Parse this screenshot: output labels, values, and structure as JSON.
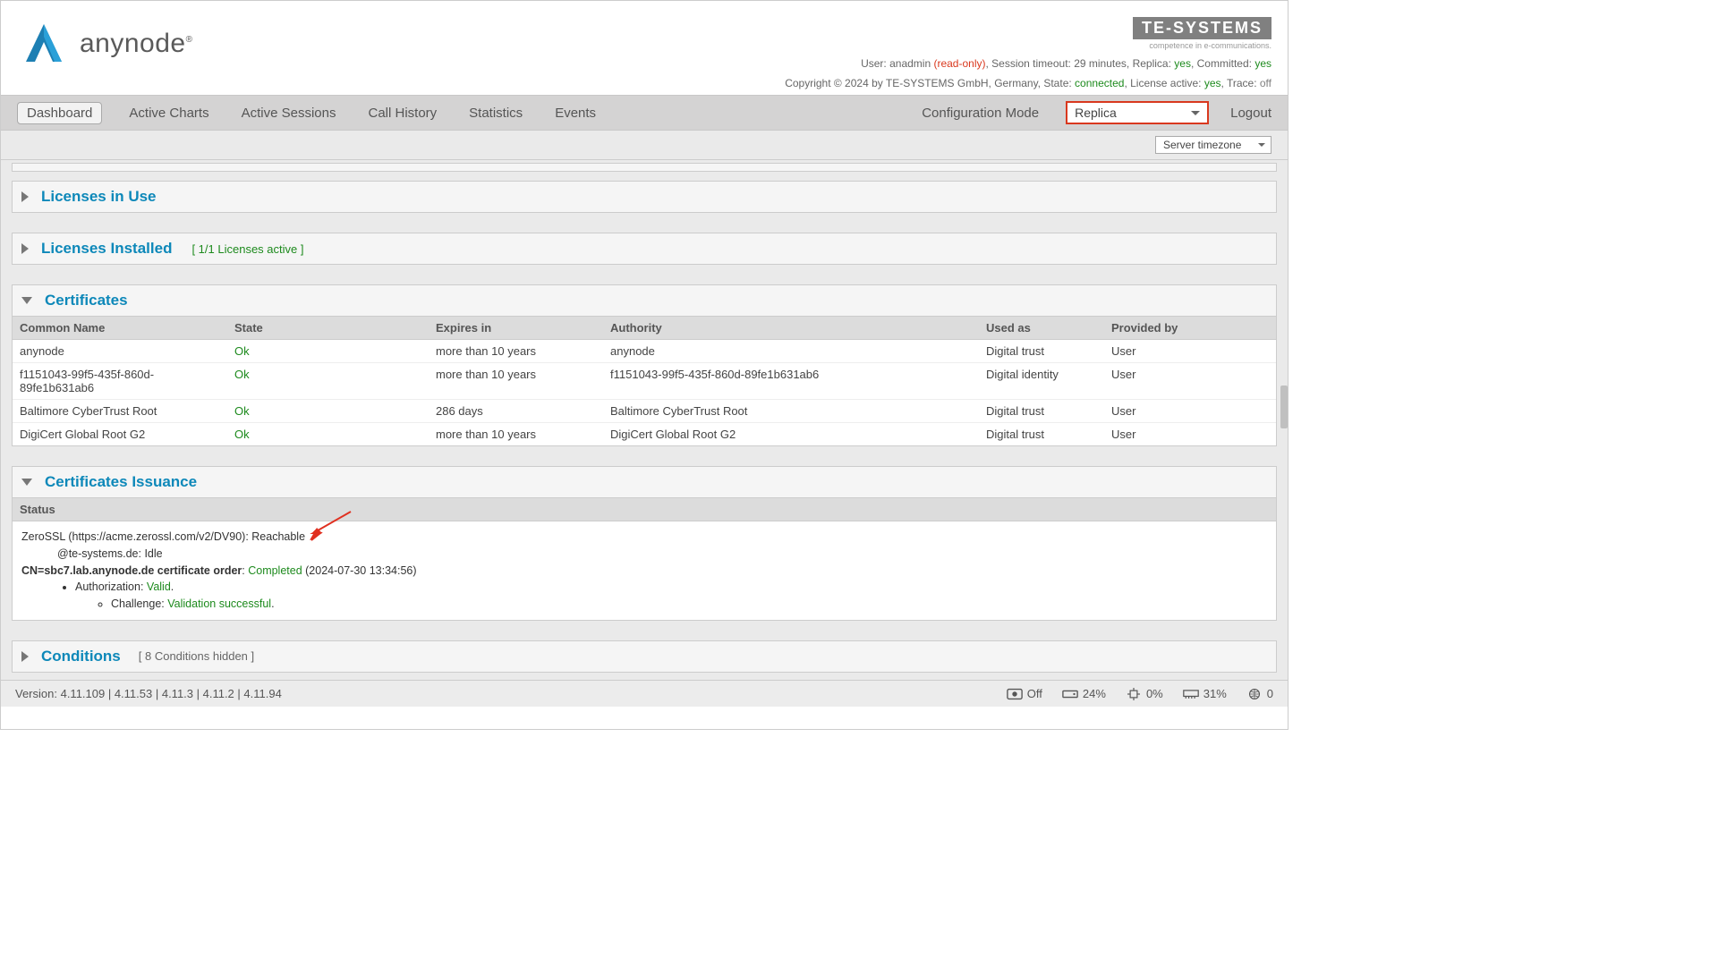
{
  "brand": {
    "name": "anynode",
    "reg": "®"
  },
  "tes": {
    "logo": "TE-SYSTEMS",
    "tagline": "competence in e-communications."
  },
  "userline": {
    "user_prefix": "User: ",
    "user": "anadmin",
    "readonly": " (read-only)",
    "sess_prefix": ", Session timeout: ",
    "sess": "29 minutes",
    "replica_prefix": ", Replica: ",
    "replica": "yes",
    "committed_prefix": ", Committed: ",
    "committed": "yes"
  },
  "copyline": {
    "prefix": "Copyright © 2024 by TE-SYSTEMS GmbH, Germany, State: ",
    "state": "connected",
    "lic_prefix": ", License active: ",
    "lic": "yes",
    "trace_prefix": ", Trace: ",
    "trace": "off"
  },
  "nav": {
    "dashboard": "Dashboard",
    "active_charts": "Active Charts",
    "active_sessions": "Active Sessions",
    "call_history": "Call History",
    "statistics": "Statistics",
    "events": "Events",
    "config_mode": "Configuration Mode",
    "replica": "Replica",
    "logout": "Logout"
  },
  "sec": {
    "tz": "Server timezone"
  },
  "panels": {
    "licenses_use": "Licenses in Use",
    "licenses_installed": "Licenses Installed",
    "licenses_installed_sub": "[ 1/1 Licenses active ]",
    "certificates": "Certificates",
    "cert_issuance": "Certificates Issuance",
    "conditions": "Conditions",
    "conditions_sub": "[ 8 Conditions hidden ]"
  },
  "cert_table": {
    "headers": {
      "cn": "Common Name",
      "state": "State",
      "expires": "Expires in",
      "authority": "Authority",
      "used": "Used as",
      "provided": "Provided by"
    },
    "rows": [
      {
        "cn": "anynode",
        "state": "Ok",
        "expires": "more than 10 years",
        "authority": "anynode",
        "used": "Digital trust",
        "provided": "User"
      },
      {
        "cn": "f1151043-99f5-435f-860d-89fe1b631ab6",
        "state": "Ok",
        "expires": "more than 10 years",
        "authority": "f1151043-99f5-435f-860d-89fe1b631ab6",
        "used": "Digital identity",
        "provided": "User"
      },
      {
        "cn": "Baltimore CyberTrust Root",
        "state": "Ok",
        "expires": "286 days",
        "authority": "Baltimore CyberTrust Root",
        "used": "Digital trust",
        "provided": "User"
      },
      {
        "cn": "DigiCert Global Root G2",
        "state": "Ok",
        "expires": "more than 10 years",
        "authority": "DigiCert Global Root G2",
        "used": "Digital trust",
        "provided": "User"
      }
    ]
  },
  "issuance": {
    "status_label": "Status",
    "line1a": "ZeroSSL (https://acme.zerossl.com/v2/DV90): ",
    "line1b": "Reachable",
    "line2a": "@te-systems.de: ",
    "line2b": "Idle",
    "line3a": "CN=sbc7.lab.anynode.de certificate order",
    "line3b": ": ",
    "line3c": "Completed",
    "line3d": " (2024-07-30 13:34:56)",
    "auth_a": "Authorization: ",
    "auth_b": "Valid",
    "auth_c": ".",
    "chal_a": "Challenge: ",
    "chal_b": "Validation successful",
    "chal_c": "."
  },
  "status": {
    "version": "Version: 4.11.109 | 4.11.53 | 4.11.3 | 4.11.2 | 4.11.94",
    "off": "Off",
    "disk": "24%",
    "cpu": "0%",
    "mem": "31%",
    "net": "0"
  }
}
